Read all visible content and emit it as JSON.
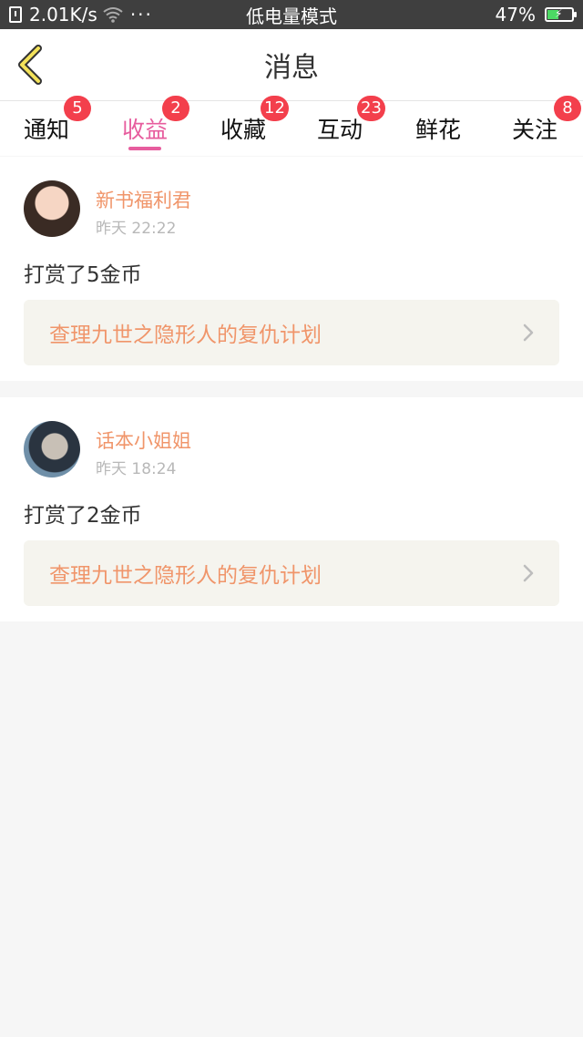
{
  "status_bar": {
    "speed": "2.01K/s",
    "dots": "···",
    "mode": "低电量模式",
    "battery_percent": "47%",
    "battery_level": 0.47
  },
  "nav": {
    "title": "消息"
  },
  "tabs": [
    {
      "label": "通知",
      "badge": "5"
    },
    {
      "label": "收益",
      "badge": "2"
    },
    {
      "label": "收藏",
      "badge": "12"
    },
    {
      "label": "互动",
      "badge": "23"
    },
    {
      "label": "鲜花",
      "badge": ""
    },
    {
      "label": "关注",
      "badge": "8"
    }
  ],
  "messages": [
    {
      "user": "新书福利君",
      "time": "昨天 22:22",
      "text": "打赏了5金币",
      "book": "查理九世之隐形人的复仇计划"
    },
    {
      "user": "话本小姐姐",
      "time": "昨天 18:24",
      "text": "打赏了2金币",
      "book": "查理九世之隐形人的复仇计划"
    }
  ],
  "colors": {
    "accent_pink": "#e75d9e",
    "orange_text": "#f0956a",
    "badge_red": "#f33f4c",
    "status_bar_bg": "#3f3f3f"
  }
}
